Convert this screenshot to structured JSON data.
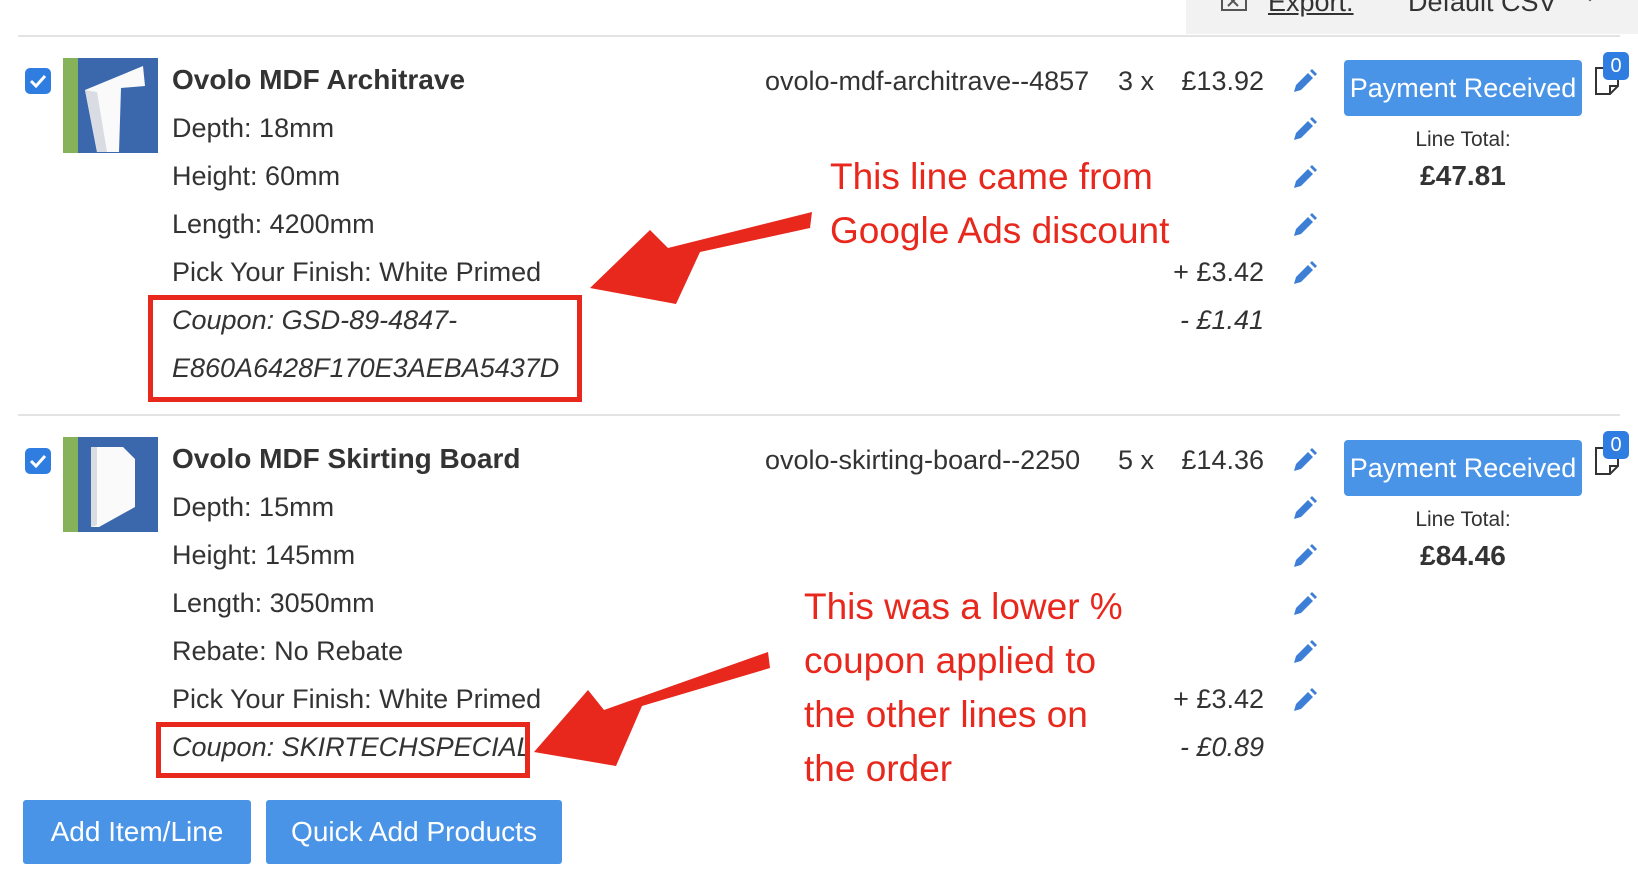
{
  "toolbar": {
    "export_label": "Export:",
    "format_label": "Default CSV"
  },
  "items": [
    {
      "name": "Ovolo MDF Architrave",
      "attributes": [
        "Depth: 18mm",
        "Height: 60mm",
        "Length: 4200mm",
        "Pick Your Finish: White Primed"
      ],
      "coupon_line1": "Coupon: GSD-89-4847-",
      "coupon_line2": "E860A6428F170E3AEBA5437D",
      "sku": "ovolo-mdf-architrave--4857",
      "qty": "3 x",
      "unit_price": "£13.92",
      "finish_surcharge": "+ £3.42",
      "coupon_discount": "- £1.41",
      "status_button": "Payment Received",
      "line_total_label": "Line Total:",
      "line_total": "£47.81",
      "notes_count": "0",
      "checked": true
    },
    {
      "name": "Ovolo MDF Skirting Board",
      "attributes": [
        "Depth: 15mm",
        "Height: 145mm",
        "Length: 3050mm",
        "Rebate: No Rebate",
        "Pick Your Finish: White Primed"
      ],
      "coupon_line1": "Coupon: SKIRTECHSPECIAL",
      "sku": "ovolo-skirting-board--2250",
      "qty": "5 x",
      "unit_price": "£14.36",
      "finish_surcharge": "+ £3.42",
      "coupon_discount": "- £0.89",
      "status_button": "Payment Received",
      "line_total_label": "Line Total:",
      "line_total": "£84.46",
      "notes_count": "0",
      "checked": true
    }
  ],
  "annotations": {
    "first_lines": [
      "This line came from",
      "Google Ads discount"
    ],
    "second_lines": [
      "This was a lower %",
      "coupon applied to",
      "the other lines on",
      "the order"
    ],
    "color": "#e8271d"
  },
  "actions": {
    "add_item_label": "Add Item/Line",
    "quick_add_label": "Quick Add Products"
  },
  "colors": {
    "primary_button": "#4a94e8",
    "checkbox": "#2f7de1",
    "annotation": "#e8271d"
  }
}
